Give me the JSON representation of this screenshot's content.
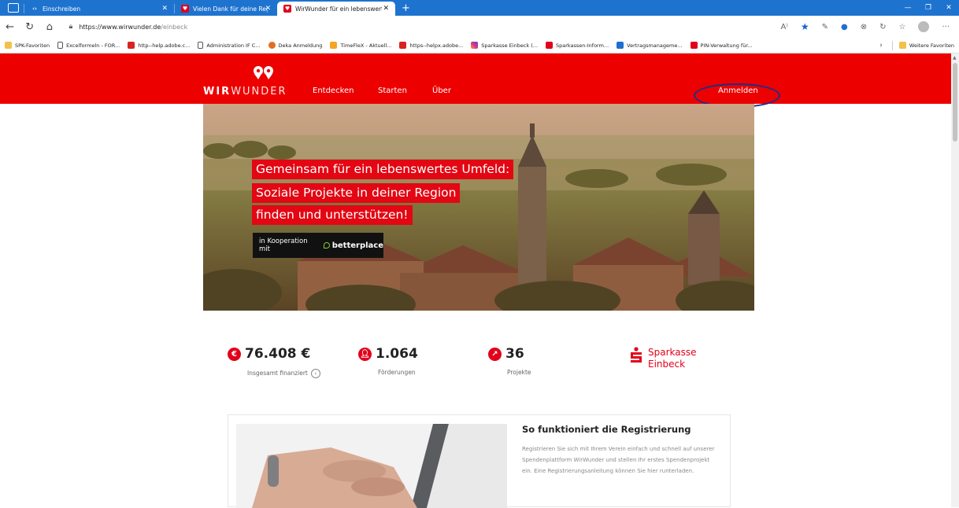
{
  "browser": {
    "tabs": [
      {
        "label": "Einschreiben",
        "state": "inactive"
      },
      {
        "label": "Vielen Dank für deine Registrier...",
        "state": "inactive"
      },
      {
        "label": "WirWunder für ein lebenswertes...",
        "state": "active"
      }
    ],
    "url_host": "https://www.wirwunder.de",
    "url_path": "/einbeck",
    "favorites": [
      {
        "label": "SPK-Favoriten",
        "icon": "folder-icon"
      },
      {
        "label": "Excelformeln - FOR...",
        "icon": "page-icon"
      },
      {
        "label": "http--help.adobe.c...",
        "icon": "adobe-icon"
      },
      {
        "label": "Administration IF C...",
        "icon": "page-icon"
      },
      {
        "label": "Deka Anmeldung",
        "icon": "deka-icon"
      },
      {
        "label": "TimeFleX - Aktuell...",
        "icon": "timeflex-icon"
      },
      {
        "label": "https--helpx.adobe...",
        "icon": "adobe-icon"
      },
      {
        "label": "Sparkasse Einbeck (...",
        "icon": "instagram-icon"
      },
      {
        "label": "Sparkassen-Inform...",
        "icon": "sparkasse-icon"
      },
      {
        "label": "Vertragsmanageme...",
        "icon": "contract-icon"
      },
      {
        "label": "PIN-Verwaltung für...",
        "icon": "sparkasse-icon"
      }
    ],
    "more_favorites": "Weitere Favoriten"
  },
  "header": {
    "logo_bold": "WIR",
    "logo_light": "WUNDER",
    "nav": [
      "Entdecken",
      "Starten",
      "Über"
    ],
    "login": "Anmelden"
  },
  "hero": {
    "lines": [
      "Gemeinsam für ein lebenswertes Umfeld:",
      "Soziale Projekte in deiner Region",
      "finden und unterstützen!"
    ],
    "coop_text": "in Kooperation mit",
    "partner": "betterplace"
  },
  "stats": [
    {
      "value": "76.408 €",
      "label": "Insgesamt finanziert",
      "icon": "euro-icon"
    },
    {
      "value": "1.064",
      "label": "Förderungen",
      "icon": "person-icon"
    },
    {
      "value": "36",
      "label": "Projekte",
      "icon": "arrow-icon"
    }
  ],
  "bank": {
    "line1": "Sparkasse",
    "line2": "Einbeck"
  },
  "registration": {
    "title": "So funktioniert die Registrierung",
    "text": "Registrieren Sie sich mit Ihrem Verein einfach und schnell auf unserer Spendenplattform WirWunder und stellen Ihr erstes Spendenprojekt ein. Eine Registrierungsanleitung können Sie hier runterladen."
  },
  "colors": {
    "brand": "#ec0000",
    "browser_blue": "#1e73cf",
    "annotation": "#1c2f8a"
  }
}
